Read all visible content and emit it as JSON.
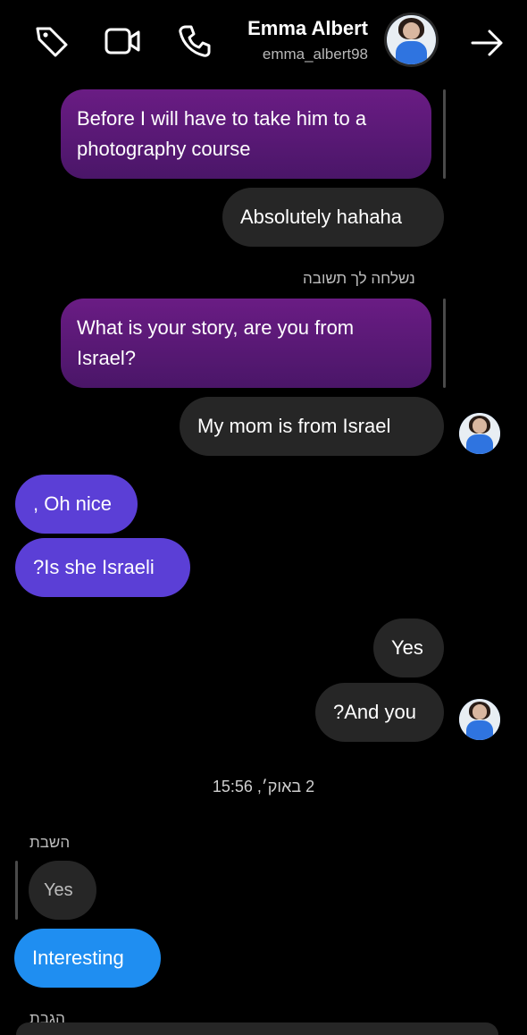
{
  "header": {
    "name": "Emma Albert",
    "username": "emma_albert98",
    "icons": [
      "tag-icon",
      "video-camera-icon",
      "phone-icon",
      "arrow-right-icon"
    ]
  },
  "messages": {
    "m1": "Before I will have to take him to a photography course",
    "m2": "Absolutely hahaha",
    "reply_note": "נשלחה לך תשובה",
    "m3": "What is your story, are you from Israel?",
    "m4": "My mom is from Israel",
    "m5": ", Oh nice",
    "m6": "?Is she Israeli",
    "m7": "Yes",
    "m8": "?And you",
    "timestamp": "2 באוק׳, 15:56",
    "reply_label": "השבת",
    "m9": "Yes",
    "m10": "Interesting",
    "bottom_label": "הגבת"
  },
  "colors": {
    "background": "#000000",
    "purple_bubble": "#5a1a78",
    "gray_bubble": "#262626",
    "violet_bubble": "#5b3fd6",
    "blue_bubble": "#1f8ef1"
  }
}
